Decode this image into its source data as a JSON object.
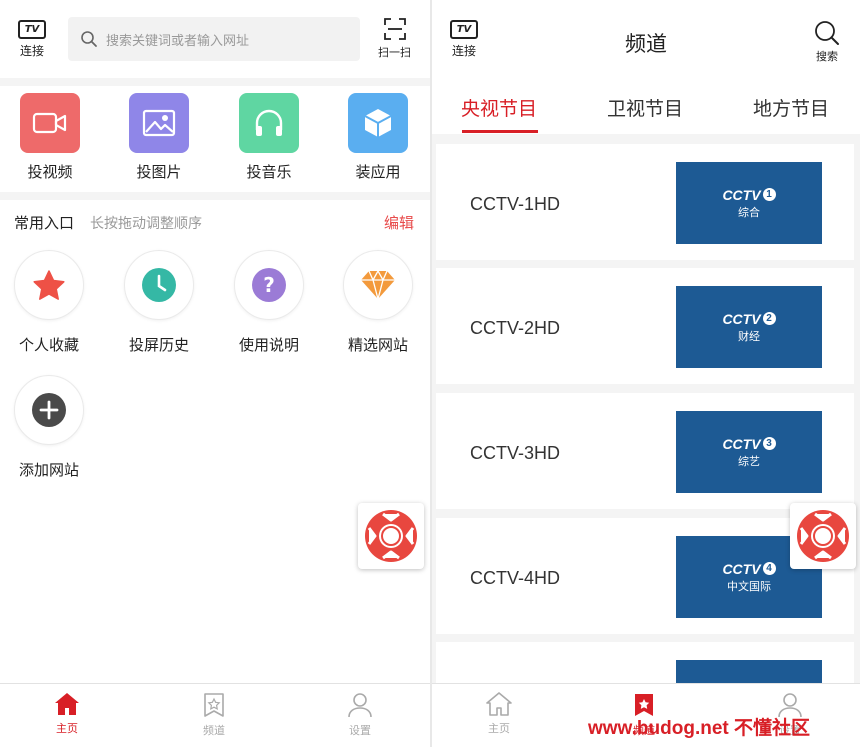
{
  "left": {
    "header": {
      "connect_badge": "TV",
      "connect_label": "连接",
      "search_placeholder": "搜索关键词或者输入网址",
      "scan_label": "扫一扫"
    },
    "cast_items": [
      {
        "label": "投视频",
        "color": "#ee6a6a",
        "icon": "video-camera-icon"
      },
      {
        "label": "投图片",
        "color": "#8f86e8",
        "icon": "image-icon"
      },
      {
        "label": "投音乐",
        "color": "#5fd6a2",
        "icon": "headphones-icon"
      },
      {
        "label": "装应用",
        "color": "#5aaef0",
        "icon": "app-box-icon"
      }
    ],
    "common": {
      "title": "常用入口",
      "hint": "长按拖动调整顺序",
      "edit": "编辑"
    },
    "shortcuts": [
      {
        "label": "个人收藏",
        "color": "#ee5146",
        "icon": "star-icon"
      },
      {
        "label": "投屏历史",
        "color": "#35b8a5",
        "icon": "clock-icon"
      },
      {
        "label": "使用说明",
        "color": "#9b7bd6",
        "icon": "question-icon"
      },
      {
        "label": "精选网站",
        "color": "#f39a3c",
        "icon": "diamond-icon"
      },
      {
        "label": "添加网站",
        "color": "#4a4a4a",
        "icon": "plus-icon"
      }
    ],
    "nav": [
      {
        "label": "主页",
        "icon": "home-icon",
        "active": true
      },
      {
        "label": "频道",
        "icon": "channel-icon",
        "active": false
      },
      {
        "label": "设置",
        "icon": "user-icon",
        "active": false
      }
    ]
  },
  "right": {
    "header": {
      "connect_badge": "TV",
      "connect_label": "连接",
      "title": "频道",
      "search_label": "搜索"
    },
    "tabs": [
      {
        "label": "央视节目",
        "active": true
      },
      {
        "label": "卫视节目",
        "active": false
      },
      {
        "label": "地方节目",
        "active": false
      }
    ],
    "channels": [
      {
        "name": "CCTV-1HD",
        "logo_text": "CCTV",
        "logo_num": "1",
        "logo_sub": "综合"
      },
      {
        "name": "CCTV-2HD",
        "logo_text": "CCTV",
        "logo_num": "2",
        "logo_sub": "财经"
      },
      {
        "name": "CCTV-3HD",
        "logo_text": "CCTV",
        "logo_num": "3",
        "logo_sub": "综艺"
      },
      {
        "name": "CCTV-4HD",
        "logo_text": "CCTV",
        "logo_num": "4",
        "logo_sub": "中文国际"
      }
    ],
    "nav": [
      {
        "label": "主页",
        "icon": "home-icon",
        "active": false
      },
      {
        "label": "频道",
        "icon": "channel-icon",
        "active": true
      },
      {
        "label": "设置",
        "icon": "user-icon",
        "active": false
      }
    ]
  },
  "watermark": "www.budog.net 不懂社区",
  "colors": {
    "accent": "#d81f26",
    "logo_blue": "#1d5a94"
  }
}
